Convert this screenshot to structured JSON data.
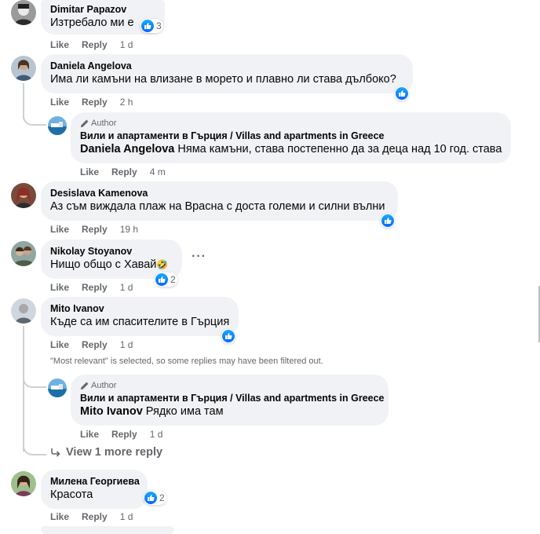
{
  "common": {
    "like": "Like",
    "reply": "Reply"
  },
  "colors": {
    "bubble": "#f0f2f5",
    "like_blue": "#0866ff",
    "meta_gray": "#65676b"
  },
  "comments": [
    {
      "name": "Dimitar Papazov",
      "text": "Изтребало ми е",
      "time": "1 d",
      "reactions": "3"
    },
    {
      "name": "Daniela Angelova",
      "text": "Има ли камъни на влизане в морето и плавно ли става дълбоко?",
      "time": "2 h"
    },
    {
      "name": "Desislava Kamenova",
      "text": "Аз съм виждала плаж на Врасна с доста големи и силни вълни",
      "time": "19 h"
    },
    {
      "name": "Nikolay Stoyanov",
      "text": "Нищо общо с Хавай",
      "emoji": "🤣",
      "time": "1 d",
      "reactions": "2"
    },
    {
      "name": "Mito Ivanov",
      "text": "Къде са им спасителите в Гърция",
      "time": "1 d"
    },
    {
      "name": "Милена Георгиева",
      "text": "Красота",
      "time": "1 d",
      "reactions": "2"
    }
  ],
  "replies": [
    {
      "badge": "Author",
      "name": "Вили и апартаменти в Гърция / Villas and apartments in Greece",
      "mention": "Daniela Angelova",
      "text": "Няма камъни, става постепенно да за деца над 10 год. става",
      "time": "4 m"
    },
    {
      "badge": "Author",
      "name": "Вили и апартаменти в Гърция / Villas and apartments in Greece",
      "mention": "Mito Ivanov",
      "text": "Рядко има там",
      "time": "1 d"
    }
  ],
  "filter_notice": "\"Most relevant\" is selected, so some replies may have been filtered out.",
  "view_more": "View 1 more reply",
  "icons": [
    "like-icon",
    "pencil-icon",
    "reply-arrow-icon",
    "more-options-icon"
  ]
}
